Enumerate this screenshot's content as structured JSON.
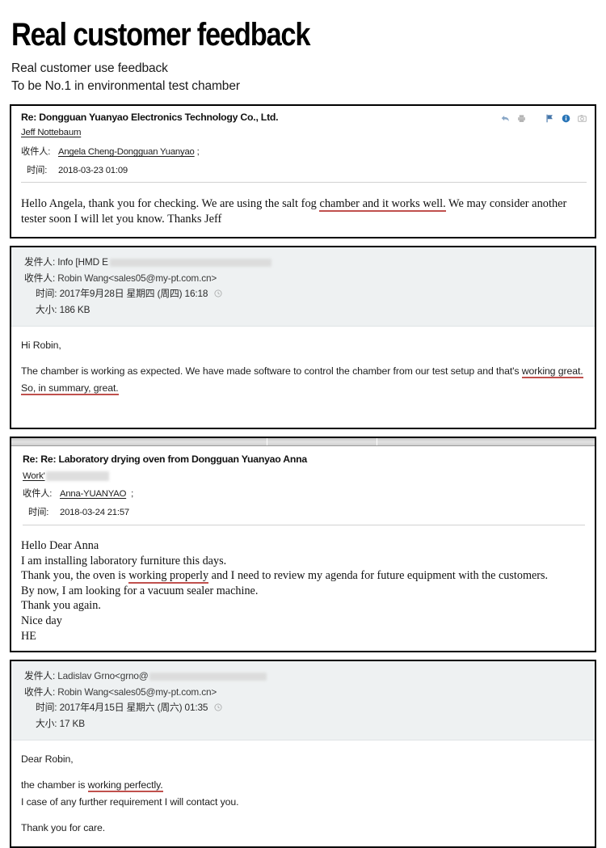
{
  "header": {
    "title": "Real customer feedback",
    "subtitle_1": "Real customer use feedback",
    "subtitle_2": "To be No.1 in environmental test chamber"
  },
  "colors": {
    "highlight_underline": "#c0504d",
    "gray_header_bg": "#eef1f2",
    "card_border": "#000000",
    "icon_blue": "#1f6fb5"
  },
  "emails": [
    {
      "id": "email-1",
      "subject": "Re: Dongguan Yuanyao Electronics Technology Co., Ltd.",
      "from_name": "Jeff Nottebaum",
      "to_label": "收件人:",
      "to_value": "Angela Cheng-Dongguan Yuanyao",
      "to_semicolon": ";",
      "time_label": "时间:",
      "time_value": "2018-03-23 01:09",
      "icons": [
        "reply-icon",
        "print-icon",
        "flag-icon",
        "info-icon",
        "camera-icon"
      ],
      "body_part_1": "Hello Angela, thank you for checking. We are using the salt fog ",
      "body_highlight": "chamber and it works well.",
      "body_part_2": " We may consider another tester soon I will let you know. Thanks Jeff"
    },
    {
      "id": "email-2",
      "from_label": "发件人:",
      "from_value": "Info [HMD E",
      "from_redacted": true,
      "to_label": "收件人:",
      "to_value": "Robin Wang<sales05@my-pt.com.cn>",
      "time_label": "时间:",
      "time_value": "2017年9月28日 星期四 (周四) 16:18",
      "time_icon": "clock-icon",
      "size_label": "大小:",
      "size_value": "186 KB",
      "greeting": "Hi Robin,",
      "body_part_1": "The chamber is working as expected. We have made software to control the chamber from our test setup and that's ",
      "body_highlight_1": "working great.",
      "body_highlight_2": "So, in summary, great."
    },
    {
      "id": "email-3",
      "subject": "Re: Re: Laboratory drying oven from Dongguan Yuanyao Anna",
      "from_name": "Work'",
      "from_redacted": true,
      "to_label": "收件人:",
      "to_value": "Anna-YUANYAO",
      "to_semicolon": ";",
      "time_label": "时间:",
      "time_value": "2018-03-24 21:57",
      "body_lines": [
        "Hello Dear Anna",
        "I am installing laboratory furniture this days.",
        "Thank you again.",
        "Nice day",
        "HE"
      ],
      "body_line_thanks_pre": "Thank you, the oven is ",
      "body_line_thanks_hl": "working properly",
      "body_line_thanks_post": " and I need to review my agenda for future equipment with the customers.",
      "body_line_bynow": "By now, I am looking  for a vacuum sealer machine."
    },
    {
      "id": "email-4",
      "from_label": "发件人:",
      "from_value": "Ladislav Grno<grno@",
      "from_redacted": true,
      "to_label": "收件人:",
      "to_value": "Robin Wang<sales05@my-pt.com.cn>",
      "time_label": "时间:",
      "time_value": "2017年4月15日 星期六 (周六) 01:35",
      "time_icon": "clock-icon",
      "size_label": "大小:",
      "size_value": "17 KB",
      "greeting": "Dear Robin,",
      "body_part_1": "the chamber is ",
      "body_highlight": "working perfectly.",
      "body_line_2": "I case of any further requirement I will contact you.",
      "body_line_3": "Thank you for care."
    }
  ]
}
